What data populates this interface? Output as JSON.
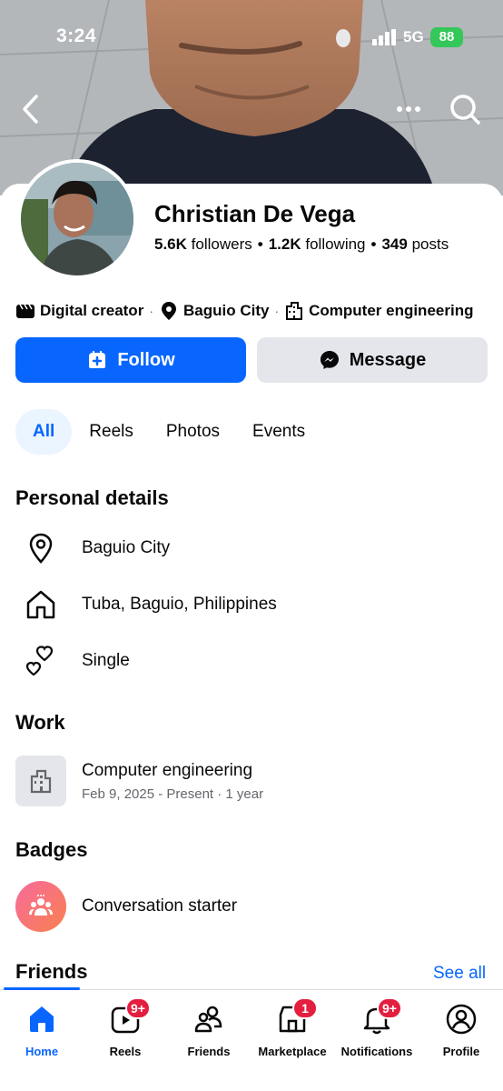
{
  "status_bar": {
    "time": "3:24",
    "network": "5G",
    "battery": "88"
  },
  "header": {
    "back_icon": "chevron-left-icon",
    "more_icon": "ellipsis-icon",
    "search_icon": "search-icon"
  },
  "profile": {
    "name": "Christian De Vega",
    "followers_count": "5.6K",
    "followers_label": "followers",
    "following_count": "1.2K",
    "following_label": "following",
    "posts_count": "349",
    "posts_label": "posts",
    "separator": "•"
  },
  "intro": {
    "category": "Digital creator",
    "location": "Baguio City",
    "work": "Computer engineering",
    "separator": "·"
  },
  "actions": {
    "follow_label": "Follow",
    "message_label": "Message"
  },
  "tabs": [
    {
      "label": "All",
      "active": true
    },
    {
      "label": "Reels"
    },
    {
      "label": "Photos"
    },
    {
      "label": "Events"
    }
  ],
  "personal_details": {
    "title": "Personal details",
    "items": [
      {
        "icon": "location-pin-icon",
        "text": "Baguio City"
      },
      {
        "icon": "home-icon",
        "text": "Tuba, Baguio, Philippines"
      },
      {
        "icon": "hearts-icon",
        "text": "Single"
      }
    ]
  },
  "work": {
    "title": "Work",
    "item": {
      "title": "Computer engineering",
      "subtitle": "Feb 9, 2025 - Present · 1 year"
    }
  },
  "badges": {
    "title": "Badges",
    "item": "Conversation starter"
  },
  "friends": {
    "title": "Friends",
    "see_all": "See all"
  },
  "bottom_nav": [
    {
      "label": "Home",
      "icon": "home-icon",
      "active": true
    },
    {
      "label": "Reels",
      "icon": "reels-icon",
      "badge": "9+"
    },
    {
      "label": "Friends",
      "icon": "friends-icon"
    },
    {
      "label": "Marketplace",
      "icon": "marketplace-icon",
      "badge": "1"
    },
    {
      "label": "Notifications",
      "icon": "bell-icon",
      "badge": "9+"
    },
    {
      "label": "Profile",
      "icon": "profile-icon"
    }
  ],
  "colors": {
    "brand": "#0866ff",
    "badge": "#e41e3f",
    "muted": "#65676b",
    "button_secondary": "#e4e6eb"
  }
}
